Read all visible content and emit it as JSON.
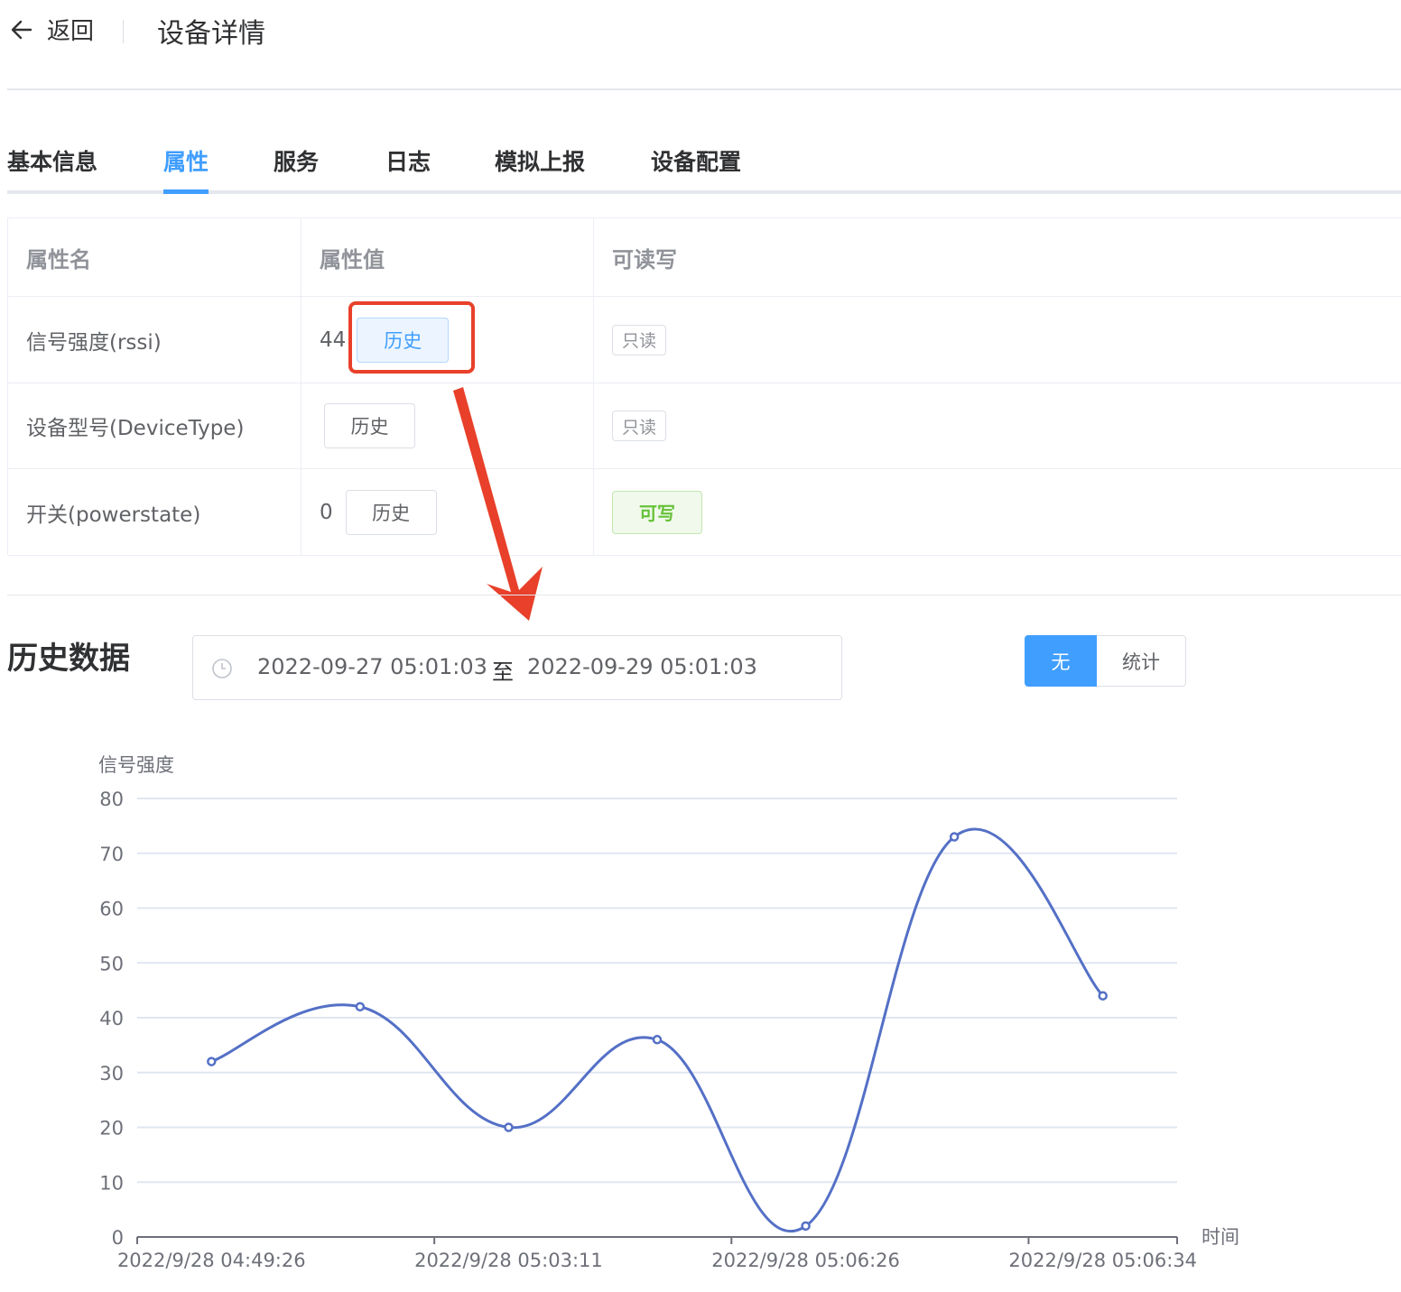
{
  "header": {
    "back_label": "返回",
    "title": "设备详情"
  },
  "tabs": [
    {
      "label": "基本信息",
      "active": false
    },
    {
      "label": "属性",
      "active": true
    },
    {
      "label": "服务",
      "active": false
    },
    {
      "label": "日志",
      "active": false
    },
    {
      "label": "模拟上报",
      "active": false
    },
    {
      "label": "设备配置",
      "active": false
    }
  ],
  "table": {
    "headers": [
      "属性名",
      "属性值",
      "可读写"
    ],
    "rows": [
      {
        "name": "信号强度(rssi)",
        "value": "44",
        "history_label": "历史",
        "access": "只读"
      },
      {
        "name": "设备型号(DeviceType)",
        "value": "",
        "history_label": "历史",
        "access": "只读"
      },
      {
        "name": "开关(powerstate)",
        "value": "0",
        "history_label": "历史",
        "access": "可写"
      }
    ]
  },
  "history": {
    "title": "历史数据",
    "range_start": "2022-09-27 05:01:03",
    "range_separator": "至",
    "range_end": "2022-09-29 05:01:03",
    "mode_options": [
      "无",
      "统计"
    ],
    "selected_mode": "无"
  },
  "colors": {
    "accent": "#409eff",
    "annotation": "#e8402a",
    "line": "#5470c6",
    "success": "#67c23a"
  },
  "chart_data": {
    "type": "line",
    "ylabel": "信号强度",
    "xlabel": "时间",
    "ylim": [
      0,
      80
    ],
    "yticks": [
      0,
      10,
      20,
      30,
      40,
      50,
      60,
      70,
      80
    ],
    "x_tick_labels": [
      "2022/9/28 04:49:26",
      "2022/9/28 05:03:11",
      "2022/9/28 05:06:26",
      "2022/9/28 05:06:34"
    ],
    "values": [
      32,
      42,
      20,
      36,
      2,
      73,
      44
    ],
    "smooth": true,
    "grid": true
  }
}
